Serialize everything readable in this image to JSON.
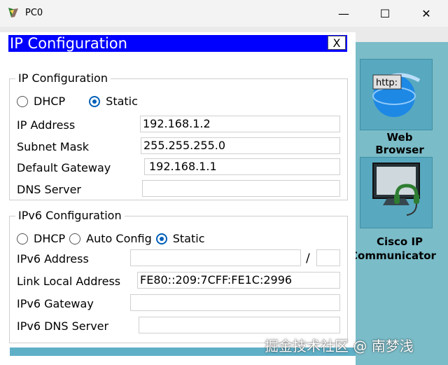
{
  "window": {
    "title": "PC0",
    "minimize_glyph": "—",
    "maximize_glyph": "☐",
    "close_glyph": "✕"
  },
  "desktop_tiles": [
    {
      "label_line1": "Web",
      "label_line2": "Browser",
      "icon": "web-browser-icon",
      "badge": "http:"
    },
    {
      "label_line1": "Cisco IP",
      "label_line2": "Communicator",
      "icon": "cisco-ip-communicator-icon"
    }
  ],
  "dialog": {
    "title": "IP Configuration",
    "close_label": "X",
    "ipv4": {
      "group_title": "IP Configuration",
      "dhcp_label": "DHCP",
      "static_label": "Static",
      "selected_mode": "Static",
      "ip_address_label": "IP Address",
      "ip_address": "192.168.1.2",
      "subnet_mask_label": "Subnet Mask",
      "subnet_mask": "255.255.255.0",
      "default_gateway_label": "Default Gateway",
      "default_gateway": "192.168.1.1",
      "dns_server_label": "DNS Server",
      "dns_server": ""
    },
    "ipv6": {
      "group_title": "IPv6 Configuration",
      "dhcp_label": "DHCP",
      "auto_config_label": "Auto Config",
      "static_label": "Static",
      "selected_mode": "Static",
      "ipv6_address_label": "IPv6 Address",
      "ipv6_address": "",
      "prefix_separator": "/",
      "prefix_length": "",
      "link_local_label": "Link Local Address",
      "link_local_address": "FE80::209:7CFF:FE1C:2996",
      "ipv6_gateway_label": "IPv6 Gateway",
      "ipv6_gateway": "",
      "ipv6_dns_label": "IPv6 DNS Server",
      "ipv6_dns": ""
    }
  },
  "watermark": "掘金技术社区 @ 南梦浅",
  "colors": {
    "dialog_header": "#0000ff",
    "radio_checked": "#005fb8",
    "side_panel": "#7abcc8"
  }
}
